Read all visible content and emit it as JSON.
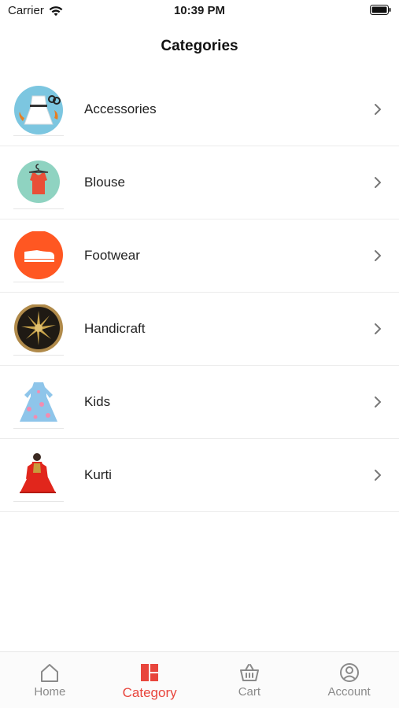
{
  "status_bar": {
    "carrier": "Carrier",
    "time": "10:39 PM"
  },
  "nav": {
    "title": "Categories"
  },
  "categories": [
    {
      "label": "Accessories",
      "icon": "accessories-thumbnail"
    },
    {
      "label": "Blouse",
      "icon": "blouse-thumbnail"
    },
    {
      "label": "Footwear",
      "icon": "footwear-thumbnail"
    },
    {
      "label": "Handicraft",
      "icon": "handicraft-thumbnail"
    },
    {
      "label": "Kids",
      "icon": "kids-dress-thumbnail"
    },
    {
      "label": "Kurti",
      "icon": "kurti-thumbnail"
    }
  ],
  "tab_bar": {
    "active_color": "#e8453c",
    "inactive_color": "#8a8a8a",
    "tabs": [
      {
        "label": "Home",
        "icon": "home-icon",
        "active": false
      },
      {
        "label": "Category",
        "icon": "category-icon",
        "active": true
      },
      {
        "label": "Cart",
        "icon": "basket-icon",
        "active": false
      },
      {
        "label": "Account",
        "icon": "account-icon",
        "active": false
      }
    ]
  }
}
